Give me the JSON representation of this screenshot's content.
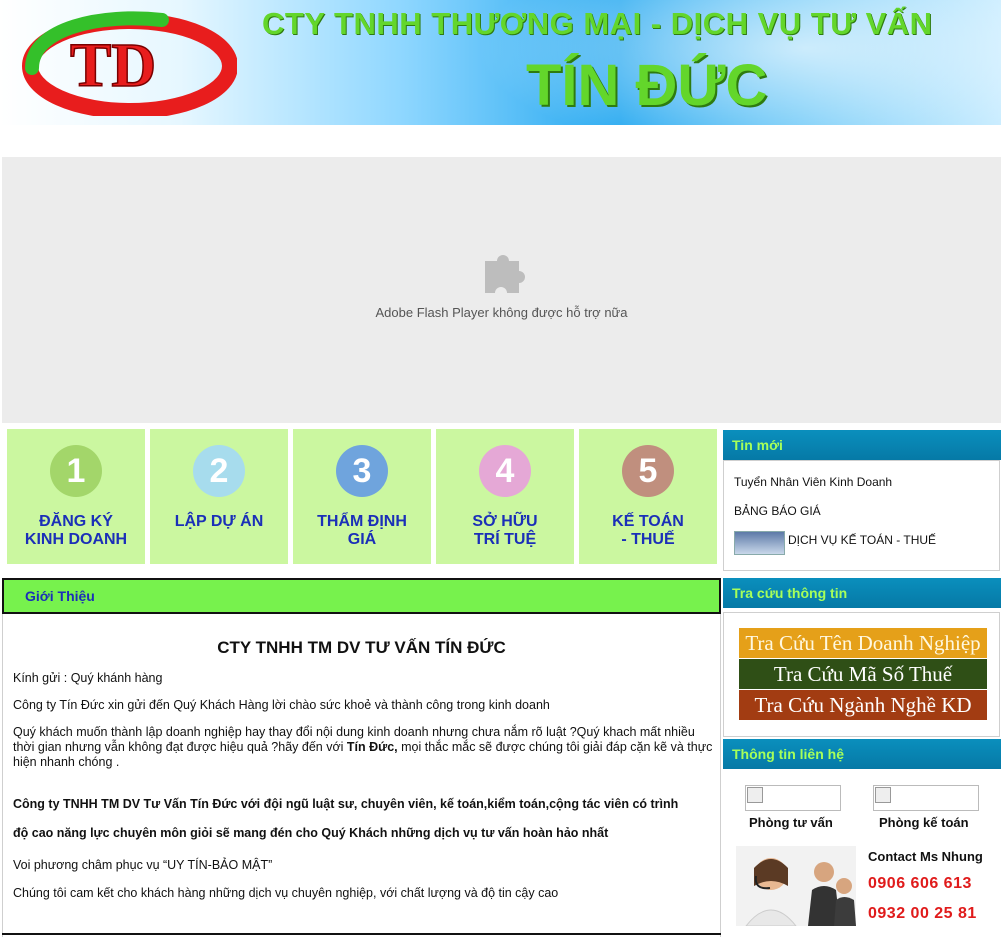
{
  "header": {
    "logo_text": "TD",
    "company_line1": "CTY TNHH THƯƠNG MẠI - DỊCH VỤ TƯ VẤN",
    "company_line2": "TÍN ĐỨC"
  },
  "flash": {
    "icon": "puzzle-icon",
    "message": "Adobe Flash Player không được hỗ trợ nữa"
  },
  "services": [
    {
      "number": "1",
      "line1": "ĐĂNG KÝ",
      "line2": "KINH DOANH",
      "color": "#a3d66a"
    },
    {
      "number": "2",
      "line1": "LẬP DỰ ÁN",
      "line2": "",
      "color": "#a7dced"
    },
    {
      "number": "3",
      "line1": "THẨM ĐỊNH",
      "line2": "GIÁ",
      "color": "#6fa4dd"
    },
    {
      "number": "4",
      "line1": "SỞ HỮU",
      "line2": "TRÍ TUỆ",
      "color": "#e5a8d6"
    },
    {
      "number": "5",
      "line1": "KẾ TOÁN",
      "line2": "- THUẾ",
      "color": "#c08f7e"
    }
  ],
  "sidebar": {
    "news_title": "Tin mới",
    "news_items": [
      "Tuyển Nhân Viên Kinh Doanh",
      "BẢNG BÁO GIÁ",
      "DỊCH VỤ KẾ TOÁN - THUẾ"
    ],
    "lookup_title": "Tra cứu thông tin",
    "lookups": [
      {
        "label": "Tra Cứu Tên Doanh Nghiệp",
        "color": "#e5a019"
      },
      {
        "label": "Tra Cứu Mã Số Thuế",
        "color": "#2f4f16"
      },
      {
        "label": "Tra Cứu Ngành Nghề KD",
        "color": "#a23c12"
      }
    ],
    "contact_title": "Thông tin liên hệ",
    "contact_consult": "Phòng tư vấn",
    "contact_accounting": "Phòng kế toán",
    "contact_name": "Contact Ms Nhung",
    "phone1": "0906 606 613",
    "phone2": "0932 00 25 81"
  },
  "intro": {
    "section_title": "Giới Thiệu",
    "heading": "CTY TNHH TM DV TƯ VẤN TÍN ĐỨC",
    "greeting": "Kính gửi : Quý khánh hàng",
    "p1": "Công ty Tín Đức xin gửi đến Quý Khách Hàng lời chào sức khoẻ và thành công trong kinh doanh",
    "p2_a": "Quý khách  muốn thành lập doanh nghiệp hay thay đổi nội dung kinh doanh nhưng chưa nắm rõ luật ?Quý khach mất nhiều thời gian nhưng vẫn không đạt được hiệu quả ?hãy đến với ",
    "p2_strong": "Tín Đức,",
    "p2_b": " mọi thắc mắc sẽ được chúng tôi giải đáp cặn kẽ và thực hiện nhanh chóng .",
    "bold_line1": "Công ty TNHH TM DV Tư Vấn Tín Đức với đội ngũ luật sư, chuyên viên, kế toán,kiểm toán,cộng tác viên có trình",
    "bold_line2": "độ cao năng lực chuyên môn giỏi sẽ mang đén cho Quý Khách những dịch vụ tư vấn hoàn hảo nhất",
    "motto": "Voi phương châm phục vụ “UY TÍN-BẢO MẬT”",
    "commit": "Chúng tôi cam kết cho khách hàng những dịch vụ chuyên nghiệp, với chất lượng và độ tin cậy cao"
  }
}
